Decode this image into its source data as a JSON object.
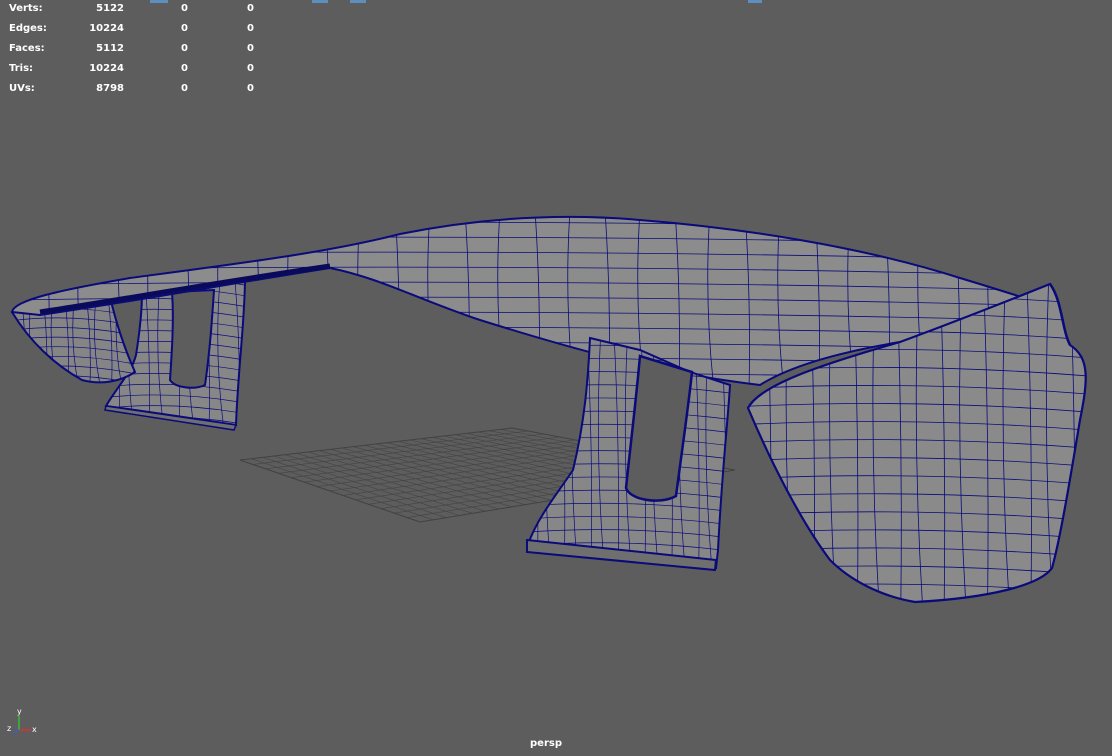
{
  "stats": {
    "rows": [
      {
        "label": "Verts:",
        "total": "5122",
        "selected": "0",
        "component": "0"
      },
      {
        "label": "Edges:",
        "total": "10224",
        "selected": "0",
        "component": "0"
      },
      {
        "label": "Faces:",
        "total": "5112",
        "selected": "0",
        "component": "0"
      },
      {
        "label": "Tris:",
        "total": "10224",
        "selected": "0",
        "component": "0"
      },
      {
        "label": "UVs:",
        "total": "8798",
        "selected": "0",
        "component": "0"
      }
    ]
  },
  "viewport": {
    "camera_label": "persp",
    "background_color": "#5d5d5d",
    "wireframe_color": "#0a0a7a",
    "surface_color": "#8a8a8a",
    "grid_color": "#3c3c3c",
    "model": "rear spoiler wing"
  },
  "axis": {
    "x_label": "x",
    "y_label": "y",
    "z_label": "z",
    "x_color": "#e03030",
    "y_color": "#30c030",
    "z_color": "#3060e0"
  }
}
